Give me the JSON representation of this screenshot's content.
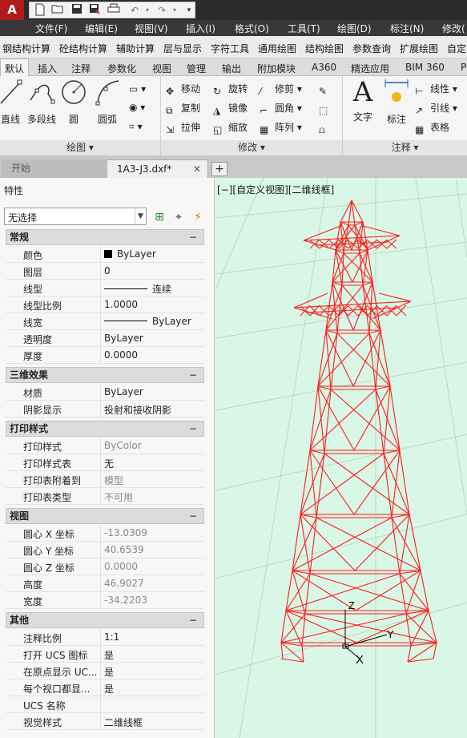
{
  "titlebar": {
    "logo_text": "A",
    "quick_access": [
      "new-icon",
      "open-icon",
      "save-icon",
      "save-as-icon",
      "print-icon",
      "undo-icon",
      "redo-icon",
      "dropdown-icon"
    ]
  },
  "menubar": {
    "items": [
      "文件(F)",
      "编辑(E)",
      "视图(V)",
      "插入(I)",
      "格式(O)",
      "工具(T)",
      "绘图(D)",
      "标注(N)",
      "修改("
    ]
  },
  "custom_toolbar": {
    "items": [
      "钢结构计算",
      "砼结构计算",
      "辅助计算",
      "层与显示",
      "字符工具",
      "通用绘图",
      "结构绘图",
      "参数查询",
      "扩展绘图",
      "自定"
    ]
  },
  "ribbon_tabs": {
    "items": [
      "默认",
      "插入",
      "注释",
      "参数化",
      "视图",
      "管理",
      "输出",
      "附加模块",
      "A360",
      "精选应用",
      "BIM 360",
      "P"
    ],
    "active": "默认"
  },
  "ribbon": {
    "draw": {
      "title": "绘图 ▾",
      "line": "直线",
      "polyline": "多段线",
      "circle": "圆",
      "arc": "圆弧"
    },
    "modify": {
      "title": "修改 ▾",
      "move": "移动",
      "rotate": "旋转",
      "trim": "修剪",
      "copy": "复制",
      "mirror": "镜像",
      "fillet": "圆角",
      "stretch": "拉伸",
      "scale": "缩放",
      "array": "阵列"
    },
    "annotation": {
      "title": "注释 ▾",
      "text": "文字",
      "dimension": "标注",
      "linear": "线性",
      "leader": "引线",
      "table": "表格"
    }
  },
  "doc_tabs": {
    "start": "开始",
    "file": "1A3-J3.dxf*",
    "close": "✕",
    "new": "+"
  },
  "properties": {
    "title": "特性",
    "selection": "无选择",
    "categories": {
      "general": "常规",
      "threed": "三维效果",
      "plot": "打印样式",
      "view": "视图",
      "misc": "其他"
    },
    "toggle": "−",
    "general": {
      "color": {
        "name": "颜色",
        "value": "ByLayer"
      },
      "layer": {
        "name": "图层",
        "value": "0"
      },
      "linetype": {
        "name": "线型",
        "value": "连续"
      },
      "ltscale": {
        "name": "线型比例",
        "value": "1.0000"
      },
      "lineweight": {
        "name": "线宽",
        "value": "ByLayer"
      },
      "transparency": {
        "name": "透明度",
        "value": "ByLayer"
      },
      "thickness": {
        "name": "厚度",
        "value": "0.0000"
      }
    },
    "threed": {
      "material": {
        "name": "材质",
        "value": "ByLayer"
      },
      "shadow": {
        "name": "阴影显示",
        "value": "投射和接收阴影"
      }
    },
    "plot": {
      "plotstyle": {
        "name": "打印样式",
        "value": "ByColor"
      },
      "plottable": {
        "name": "打印样式表",
        "value": "无"
      },
      "attached": {
        "name": "打印表附着到",
        "value": "模型"
      },
      "tabletype": {
        "name": "打印表类型",
        "value": "不可用"
      }
    },
    "view": {
      "cx": {
        "name": "圆心 X 坐标",
        "value": "-13.0309"
      },
      "cy": {
        "name": "圆心 Y 坐标",
        "value": "40.6539"
      },
      "cz": {
        "name": "圆心 Z 坐标",
        "value": "0.0000"
      },
      "height": {
        "name": "高度",
        "value": "46.9027"
      },
      "width": {
        "name": "宽度",
        "value": "-34.2203"
      }
    },
    "misc": {
      "annoscale": {
        "name": "注释比例",
        "value": "1:1"
      },
      "ucsicon": {
        "name": "打开 UCS 图标",
        "value": "是"
      },
      "ucsorigin": {
        "name": "在原点显示 UC...",
        "value": "是"
      },
      "ucsvp": {
        "name": "每个视口都显...",
        "value": "是"
      },
      "ucsname": {
        "name": "UCS 名称",
        "value": ""
      },
      "visualstyle": {
        "name": "视觉样式",
        "value": "二维线框"
      }
    }
  },
  "viewport": {
    "label": "[−][自定义视图][二维线框]",
    "background": "#d9f7e6",
    "wire_color": "#ff1a1a",
    "axis_x": "X",
    "axis_y": "Y",
    "axis_z": "Z"
  }
}
